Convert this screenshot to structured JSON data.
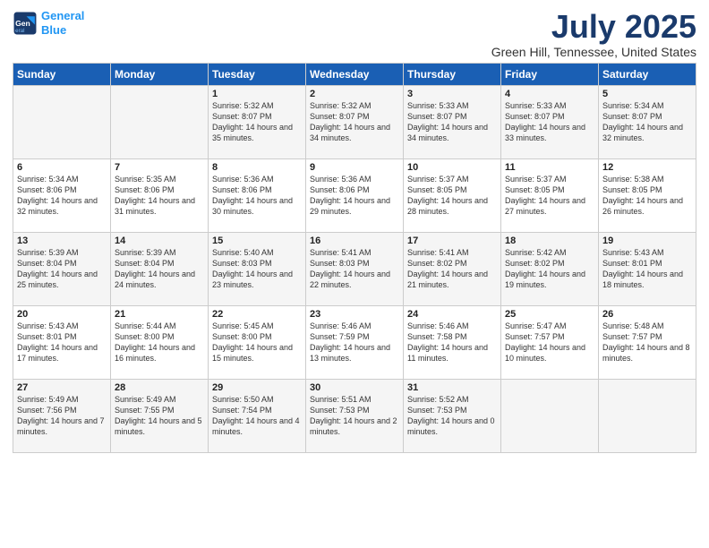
{
  "logo": {
    "line1": "General",
    "line2": "Blue"
  },
  "title": "July 2025",
  "subtitle": "Green Hill, Tennessee, United States",
  "days_of_week": [
    "Sunday",
    "Monday",
    "Tuesday",
    "Wednesday",
    "Thursday",
    "Friday",
    "Saturday"
  ],
  "weeks": [
    [
      {
        "day": "",
        "content": ""
      },
      {
        "day": "",
        "content": ""
      },
      {
        "day": "1",
        "content": "Sunrise: 5:32 AM\nSunset: 8:07 PM\nDaylight: 14 hours\nand 35 minutes."
      },
      {
        "day": "2",
        "content": "Sunrise: 5:32 AM\nSunset: 8:07 PM\nDaylight: 14 hours\nand 34 minutes."
      },
      {
        "day": "3",
        "content": "Sunrise: 5:33 AM\nSunset: 8:07 PM\nDaylight: 14 hours\nand 34 minutes."
      },
      {
        "day": "4",
        "content": "Sunrise: 5:33 AM\nSunset: 8:07 PM\nDaylight: 14 hours\nand 33 minutes."
      },
      {
        "day": "5",
        "content": "Sunrise: 5:34 AM\nSunset: 8:07 PM\nDaylight: 14 hours\nand 32 minutes."
      }
    ],
    [
      {
        "day": "6",
        "content": "Sunrise: 5:34 AM\nSunset: 8:06 PM\nDaylight: 14 hours\nand 32 minutes."
      },
      {
        "day": "7",
        "content": "Sunrise: 5:35 AM\nSunset: 8:06 PM\nDaylight: 14 hours\nand 31 minutes."
      },
      {
        "day": "8",
        "content": "Sunrise: 5:36 AM\nSunset: 8:06 PM\nDaylight: 14 hours\nand 30 minutes."
      },
      {
        "day": "9",
        "content": "Sunrise: 5:36 AM\nSunset: 8:06 PM\nDaylight: 14 hours\nand 29 minutes."
      },
      {
        "day": "10",
        "content": "Sunrise: 5:37 AM\nSunset: 8:05 PM\nDaylight: 14 hours\nand 28 minutes."
      },
      {
        "day": "11",
        "content": "Sunrise: 5:37 AM\nSunset: 8:05 PM\nDaylight: 14 hours\nand 27 minutes."
      },
      {
        "day": "12",
        "content": "Sunrise: 5:38 AM\nSunset: 8:05 PM\nDaylight: 14 hours\nand 26 minutes."
      }
    ],
    [
      {
        "day": "13",
        "content": "Sunrise: 5:39 AM\nSunset: 8:04 PM\nDaylight: 14 hours\nand 25 minutes."
      },
      {
        "day": "14",
        "content": "Sunrise: 5:39 AM\nSunset: 8:04 PM\nDaylight: 14 hours\nand 24 minutes."
      },
      {
        "day": "15",
        "content": "Sunrise: 5:40 AM\nSunset: 8:03 PM\nDaylight: 14 hours\nand 23 minutes."
      },
      {
        "day": "16",
        "content": "Sunrise: 5:41 AM\nSunset: 8:03 PM\nDaylight: 14 hours\nand 22 minutes."
      },
      {
        "day": "17",
        "content": "Sunrise: 5:41 AM\nSunset: 8:02 PM\nDaylight: 14 hours\nand 21 minutes."
      },
      {
        "day": "18",
        "content": "Sunrise: 5:42 AM\nSunset: 8:02 PM\nDaylight: 14 hours\nand 19 minutes."
      },
      {
        "day": "19",
        "content": "Sunrise: 5:43 AM\nSunset: 8:01 PM\nDaylight: 14 hours\nand 18 minutes."
      }
    ],
    [
      {
        "day": "20",
        "content": "Sunrise: 5:43 AM\nSunset: 8:01 PM\nDaylight: 14 hours\nand 17 minutes."
      },
      {
        "day": "21",
        "content": "Sunrise: 5:44 AM\nSunset: 8:00 PM\nDaylight: 14 hours\nand 16 minutes."
      },
      {
        "day": "22",
        "content": "Sunrise: 5:45 AM\nSunset: 8:00 PM\nDaylight: 14 hours\nand 15 minutes."
      },
      {
        "day": "23",
        "content": "Sunrise: 5:46 AM\nSunset: 7:59 PM\nDaylight: 14 hours\nand 13 minutes."
      },
      {
        "day": "24",
        "content": "Sunrise: 5:46 AM\nSunset: 7:58 PM\nDaylight: 14 hours\nand 11 minutes."
      },
      {
        "day": "25",
        "content": "Sunrise: 5:47 AM\nSunset: 7:57 PM\nDaylight: 14 hours\nand 10 minutes."
      },
      {
        "day": "26",
        "content": "Sunrise: 5:48 AM\nSunset: 7:57 PM\nDaylight: 14 hours\nand 8 minutes."
      }
    ],
    [
      {
        "day": "27",
        "content": "Sunrise: 5:49 AM\nSunset: 7:56 PM\nDaylight: 14 hours\nand 7 minutes."
      },
      {
        "day": "28",
        "content": "Sunrise: 5:49 AM\nSunset: 7:55 PM\nDaylight: 14 hours\nand 5 minutes."
      },
      {
        "day": "29",
        "content": "Sunrise: 5:50 AM\nSunset: 7:54 PM\nDaylight: 14 hours\nand 4 minutes."
      },
      {
        "day": "30",
        "content": "Sunrise: 5:51 AM\nSunset: 7:53 PM\nDaylight: 14 hours\nand 2 minutes."
      },
      {
        "day": "31",
        "content": "Sunrise: 5:52 AM\nSunset: 7:53 PM\nDaylight: 14 hours\nand 0 minutes."
      },
      {
        "day": "",
        "content": ""
      },
      {
        "day": "",
        "content": ""
      }
    ]
  ]
}
